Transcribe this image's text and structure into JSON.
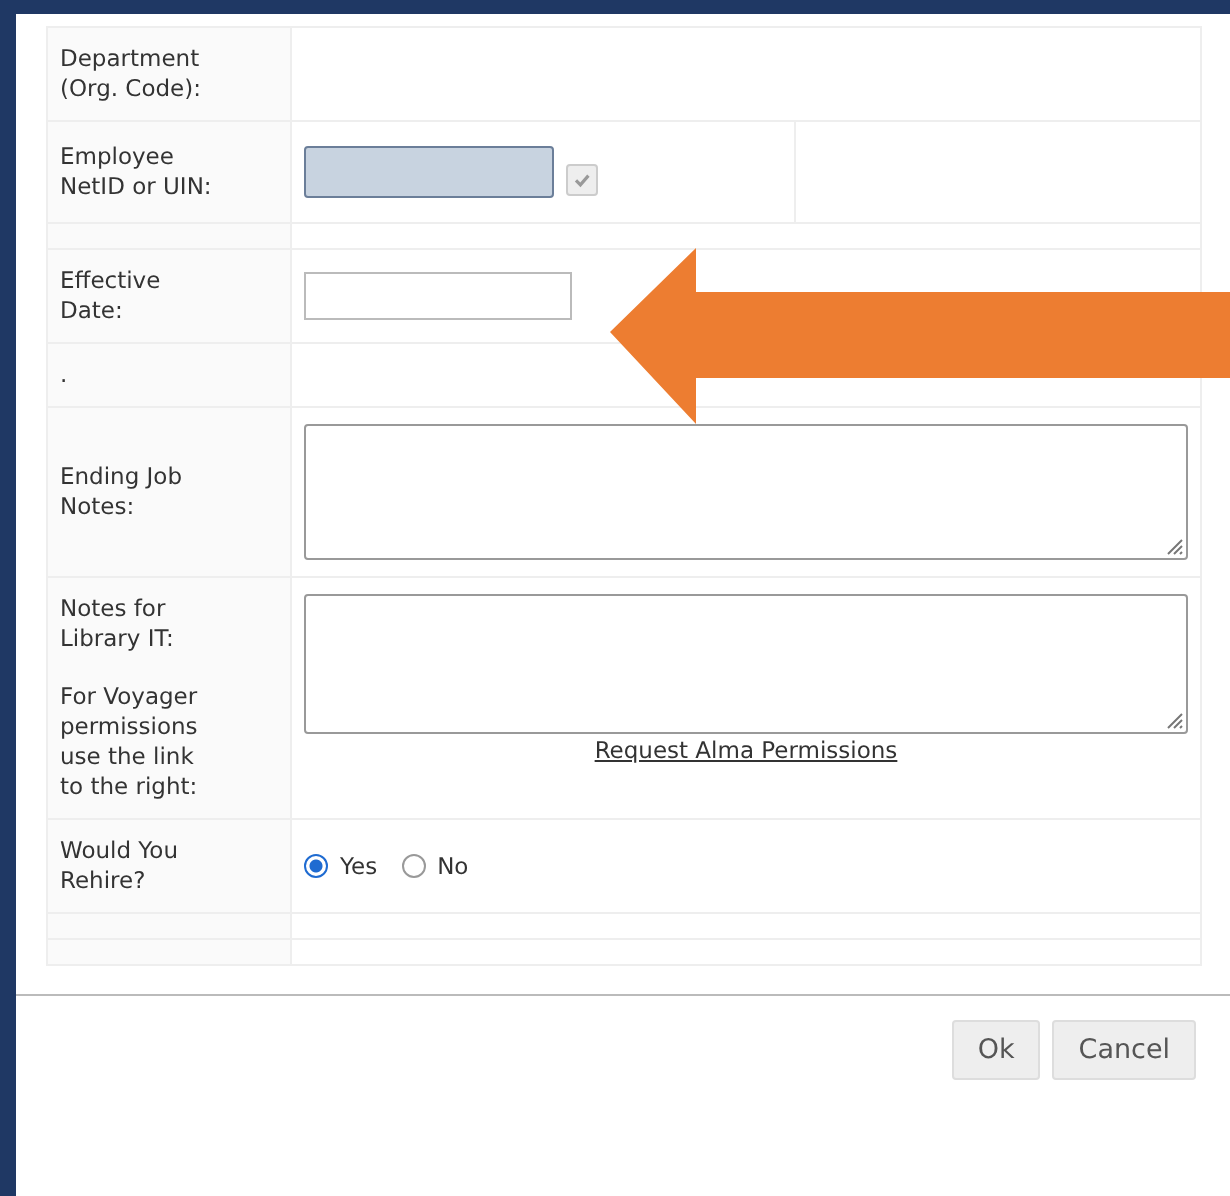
{
  "form": {
    "rows": [
      {
        "kind": "text",
        "label": "Department (Org. Code):"
      },
      {
        "kind": "netid",
        "label": "Employee NetID or UIN:",
        "checkbox": {
          "checked": true,
          "disabled": true
        }
      },
      {
        "kind": "spacer"
      },
      {
        "kind": "date",
        "label": "Effective Date:"
      },
      {
        "kind": "text",
        "label": "."
      },
      {
        "kind": "textarea",
        "label": "Ending Job Notes:"
      },
      {
        "kind": "textarea_link",
        "label": "Notes for Library IT:",
        "note": "For Voyager permissions use the link to the right:",
        "link": "Request Alma Permissions"
      },
      {
        "kind": "radio",
        "label": "Would You Rehire?",
        "options": [
          {
            "label": "Yes",
            "selected": true
          },
          {
            "label": "No",
            "selected": false
          }
        ]
      },
      {
        "kind": "spacer"
      },
      {
        "kind": "spacer"
      }
    ]
  },
  "arrow": {
    "kind": "arrow"
  },
  "buttons": [
    "Ok",
    "Cancel"
  ]
}
